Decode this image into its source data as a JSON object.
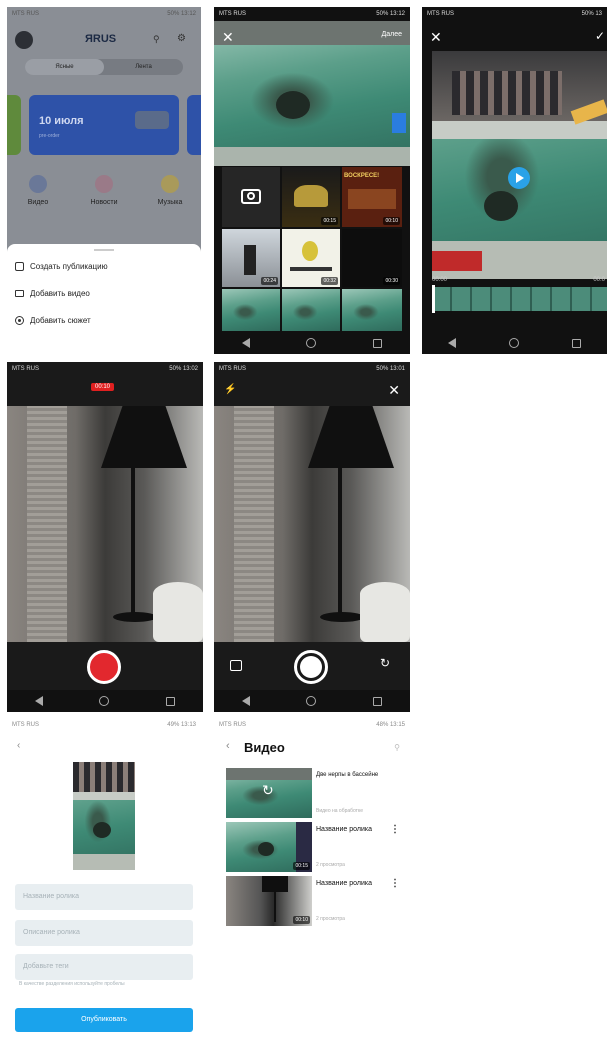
{
  "s1": {
    "status_left": "MTS RUS",
    "status_right": "50% 13:12",
    "logo": "ЯRUS",
    "tabs": [
      "Ясные",
      "Лента"
    ],
    "banner_title": "10 июля",
    "banner_sub": "pre-order",
    "categories": [
      "Видео",
      "Новости",
      "Музыка"
    ],
    "sheet_items": [
      "Создать публикацию",
      "Добавить видео",
      "Добавить сюжет"
    ]
  },
  "s2": {
    "status_left": "MTS RUS",
    "status_right": "50% 13:12",
    "next": "Далее",
    "durations": [
      "00:15",
      "00:10",
      "00:24",
      "00:32",
      "00:30"
    ],
    "poster_text": "ВОСКРЕСЕ!"
  },
  "s3": {
    "status_left": "MTS RUS",
    "status_right": "50% 13",
    "time_start": "00:00",
    "time_end": "00:0"
  },
  "s4": {
    "status_left": "MTS RUS",
    "status_right": "50% 13:02",
    "rec_time": "00:10"
  },
  "s5": {
    "status_left": "MTS RUS",
    "status_right": "50% 13:01"
  },
  "s6": {
    "status_left": "MTS RUS",
    "status_right": "49% 13:13",
    "fields": [
      "Название ролика",
      "Описание ролика",
      "Добавьте теги"
    ],
    "hint": "В качестве разделения используйте пробелы",
    "publish": "Опубликовать"
  },
  "s7": {
    "status_left": "MTS RUS",
    "status_right": "48% 13:15",
    "title": "Видео",
    "items": [
      {
        "title": "Две нерпы в бассейне",
        "sub": "Видео на обработке",
        "dur": ""
      },
      {
        "title": "Название ролика",
        "sub": "2 просмотра",
        "dur": "00:15"
      },
      {
        "title": "Название ролика",
        "sub": "2 просмотра",
        "dur": "00:10"
      }
    ]
  }
}
